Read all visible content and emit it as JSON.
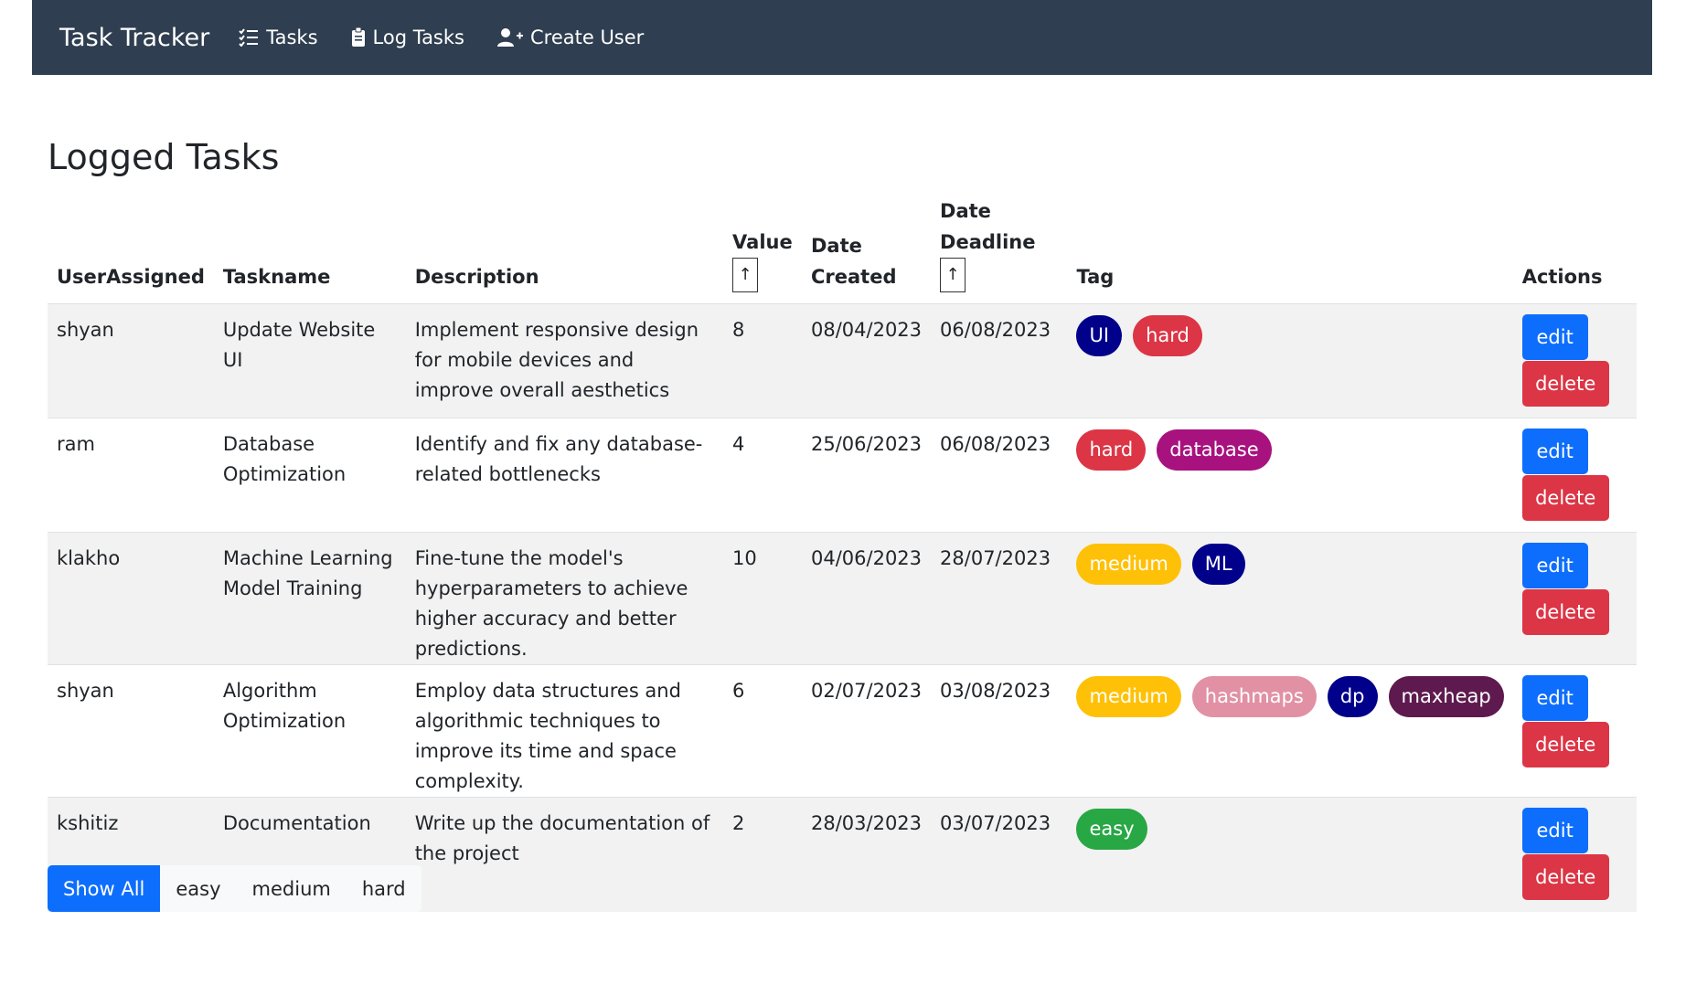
{
  "navbar": {
    "brand": "Task Tracker",
    "links": [
      {
        "label": "Tasks",
        "icon": "list-check-icon"
      },
      {
        "label": "Log Tasks",
        "icon": "clipboard-icon"
      },
      {
        "label": "Create User",
        "icon": "person-plus-icon"
      }
    ]
  },
  "page": {
    "title": "Logged Tasks"
  },
  "table": {
    "headers": {
      "user": "UserAssigned",
      "taskname": "Taskname",
      "description": "Description",
      "value": "Value",
      "date_created": "Date Created",
      "date_deadline": "Date Deadline",
      "tag": "Tag",
      "actions": "Actions"
    },
    "sort_glyph": "↑",
    "rows": [
      {
        "user": "shyan",
        "taskname": "Update Website UI",
        "description": "Implement responsive design for mobile devices and improve overall aesthetics",
        "value": "8",
        "created": "08/04/2023",
        "deadline": "06/08/2023",
        "tags": [
          {
            "label": "UI",
            "color": "#00008b"
          },
          {
            "label": "hard",
            "color": "#dc3545"
          }
        ]
      },
      {
        "user": "ram",
        "taskname": "Database Optimization",
        "description": "Identify and fix any database-related bottlenecks",
        "value": "4",
        "created": "25/06/2023",
        "deadline": "06/08/2023",
        "tags": [
          {
            "label": "hard",
            "color": "#dc3545"
          },
          {
            "label": "database",
            "color": "#a8127e"
          }
        ]
      },
      {
        "user": "klakho",
        "taskname": "Machine Learning Model Training",
        "description": "Fine-tune the model's hyperparameters to achieve higher accuracy and better predictions.",
        "value": "10",
        "created": "04/06/2023",
        "deadline": "28/07/2023",
        "tags": [
          {
            "label": "medium",
            "color": "#ffc107"
          },
          {
            "label": "ML",
            "color": "#00008b"
          }
        ]
      },
      {
        "user": "shyan",
        "taskname": "Algorithm Optimization",
        "description": "Employ data structures and algorithmic techniques to improve its time and space complexity.",
        "value": "6",
        "created": "02/07/2023",
        "deadline": "03/08/2023",
        "tags": [
          {
            "label": "medium",
            "color": "#ffc107"
          },
          {
            "label": "hashmaps",
            "color": "#e191a3"
          },
          {
            "label": "dp",
            "color": "#00008b"
          },
          {
            "label": "maxheap",
            "color": "#5e1a4e"
          }
        ]
      },
      {
        "user": "kshitiz",
        "taskname": "Documentation",
        "description": "Write up the documentation of the project",
        "value": "2",
        "created": "28/03/2023",
        "deadline": "03/07/2023",
        "tags": [
          {
            "label": "easy",
            "color": "#28a745"
          }
        ]
      }
    ],
    "actions": {
      "edit_label": "edit",
      "delete_label": "delete"
    }
  },
  "filters": [
    "Show All",
    "easy",
    "medium",
    "hard"
  ],
  "colors": {
    "navbar": "#2f3e50",
    "primary": "#0d6efd",
    "danger": "#dc3545"
  }
}
